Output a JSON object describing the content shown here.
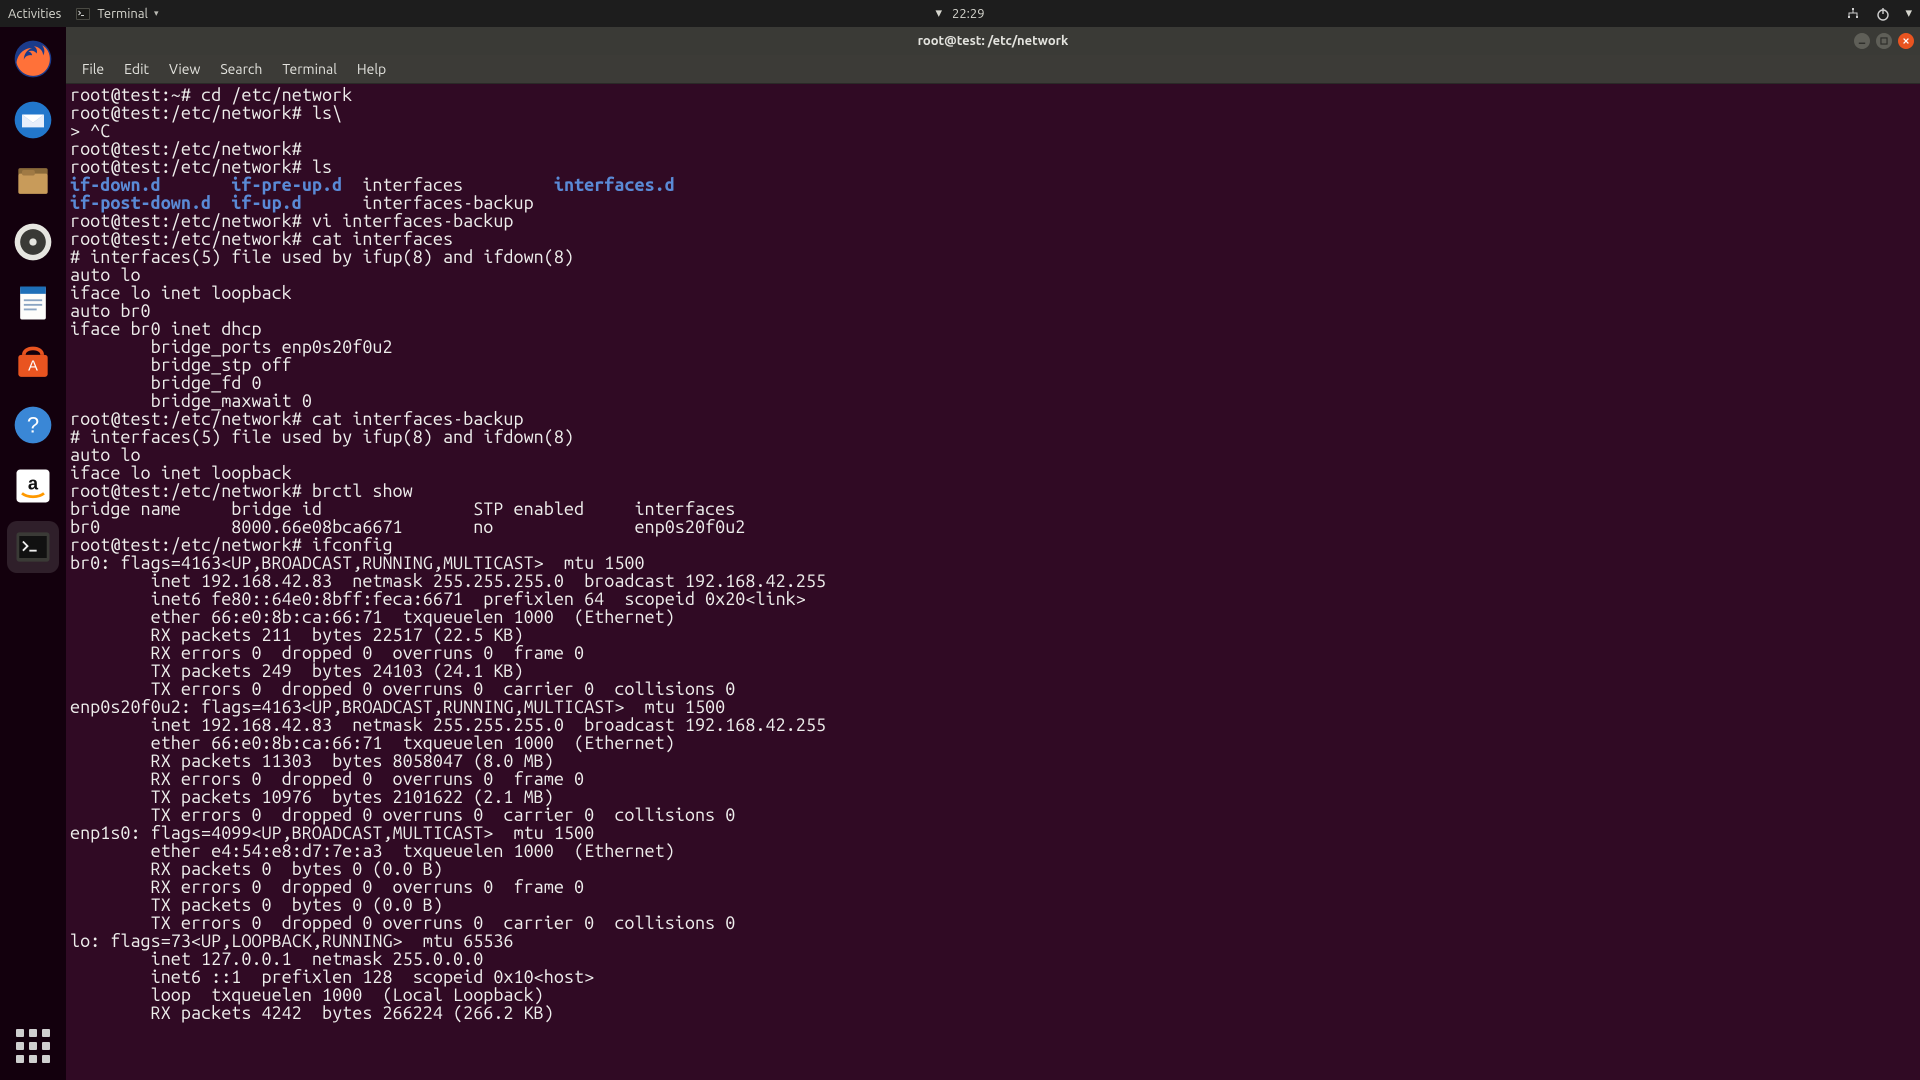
{
  "panel": {
    "activities": "Activities",
    "app_label": "Terminal",
    "clock": "22:29",
    "clock_glyph": "▾"
  },
  "dock": {
    "items": [
      {
        "name": "firefox"
      },
      {
        "name": "thunderbird"
      },
      {
        "name": "files"
      },
      {
        "name": "rhythmbox"
      },
      {
        "name": "libreoffice-writer"
      },
      {
        "name": "ubuntu-software"
      },
      {
        "name": "help"
      },
      {
        "name": "amazon"
      },
      {
        "name": "terminal"
      }
    ]
  },
  "window": {
    "title": "root@test: /etc/network",
    "menubar": [
      "File",
      "Edit",
      "View",
      "Search",
      "Terminal",
      "Help"
    ]
  },
  "terminal": {
    "lines": [
      {
        "segs": [
          {
            "t": "root@test:~# cd /etc/network"
          }
        ]
      },
      {
        "segs": [
          {
            "t": "root@test:/etc/network# ls\\"
          }
        ]
      },
      {
        "segs": [
          {
            "t": "> ^C"
          }
        ]
      },
      {
        "segs": [
          {
            "t": "root@test:/etc/network# "
          }
        ]
      },
      {
        "segs": [
          {
            "t": "root@test:/etc/network# ls"
          }
        ]
      },
      {
        "segs": [
          {
            "t": "if-down.d       ",
            "cls": "dir"
          },
          {
            "t": "if-pre-up.d",
            "cls": "dir"
          },
          {
            "t": "  interfaces         "
          },
          {
            "t": "interfaces.d",
            "cls": "dir"
          }
        ]
      },
      {
        "segs": [
          {
            "t": "if-post-down.d  ",
            "cls": "dir"
          },
          {
            "t": "if-up.d",
            "cls": "dir"
          },
          {
            "t": "      interfaces-backup"
          }
        ]
      },
      {
        "segs": [
          {
            "t": "root@test:/etc/network# vi interfaces-backup"
          }
        ]
      },
      {
        "segs": [
          {
            "t": "root@test:/etc/network# cat interfaces"
          }
        ]
      },
      {
        "segs": [
          {
            "t": "# interfaces(5) file used by ifup(8) and ifdown(8)"
          }
        ]
      },
      {
        "segs": [
          {
            "t": "auto lo"
          }
        ]
      },
      {
        "segs": [
          {
            "t": "iface lo inet loopback"
          }
        ]
      },
      {
        "segs": [
          {
            "t": ""
          }
        ]
      },
      {
        "segs": [
          {
            "t": "auto br0"
          }
        ]
      },
      {
        "segs": [
          {
            "t": "iface br0 inet dhcp"
          }
        ]
      },
      {
        "segs": [
          {
            "t": "        bridge_ports enp0s20f0u2"
          }
        ]
      },
      {
        "segs": [
          {
            "t": "        bridge_stp off"
          }
        ]
      },
      {
        "segs": [
          {
            "t": "        bridge_fd 0"
          }
        ]
      },
      {
        "segs": [
          {
            "t": "        bridge_maxwait 0"
          }
        ]
      },
      {
        "segs": [
          {
            "t": "root@test:/etc/network# cat interfaces-backup"
          }
        ]
      },
      {
        "segs": [
          {
            "t": "# interfaces(5) file used by ifup(8) and ifdown(8)"
          }
        ]
      },
      {
        "segs": [
          {
            "t": "auto lo"
          }
        ]
      },
      {
        "segs": [
          {
            "t": "iface lo inet loopback"
          }
        ]
      },
      {
        "segs": [
          {
            "t": "root@test:/etc/network# brctl show"
          }
        ]
      },
      {
        "segs": [
          {
            "t": "bridge name     bridge id               STP enabled     interfaces"
          }
        ]
      },
      {
        "segs": [
          {
            "t": "br0             8000.66e08bca6671       no              enp0s20f0u2"
          }
        ]
      },
      {
        "segs": [
          {
            "t": "root@test:/etc/network# ifconfig"
          }
        ]
      },
      {
        "segs": [
          {
            "t": "br0: flags=4163<UP,BROADCAST,RUNNING,MULTICAST>  mtu 1500"
          }
        ]
      },
      {
        "segs": [
          {
            "t": "        inet 192.168.42.83  netmask 255.255.255.0  broadcast 192.168.42.255"
          }
        ]
      },
      {
        "segs": [
          {
            "t": "        inet6 fe80::64e0:8bff:feca:6671  prefixlen 64  scopeid 0x20<link>"
          }
        ]
      },
      {
        "segs": [
          {
            "t": "        ether 66:e0:8b:ca:66:71  txqueuelen 1000  (Ethernet)"
          }
        ]
      },
      {
        "segs": [
          {
            "t": "        RX packets 211  bytes 22517 (22.5 KB)"
          }
        ]
      },
      {
        "segs": [
          {
            "t": "        RX errors 0  dropped 0  overruns 0  frame 0"
          }
        ]
      },
      {
        "segs": [
          {
            "t": "        TX packets 249  bytes 24103 (24.1 KB)"
          }
        ]
      },
      {
        "segs": [
          {
            "t": "        TX errors 0  dropped 0 overruns 0  carrier 0  collisions 0"
          }
        ]
      },
      {
        "segs": [
          {
            "t": ""
          }
        ]
      },
      {
        "segs": [
          {
            "t": "enp0s20f0u2: flags=4163<UP,BROADCAST,RUNNING,MULTICAST>  mtu 1500"
          }
        ]
      },
      {
        "segs": [
          {
            "t": "        inet 192.168.42.83  netmask 255.255.255.0  broadcast 192.168.42.255"
          }
        ]
      },
      {
        "segs": [
          {
            "t": "        ether 66:e0:8b:ca:66:71  txqueuelen 1000  (Ethernet)"
          }
        ]
      },
      {
        "segs": [
          {
            "t": "        RX packets 11303  bytes 8058047 (8.0 MB)"
          }
        ]
      },
      {
        "segs": [
          {
            "t": "        RX errors 0  dropped 0  overruns 0  frame 0"
          }
        ]
      },
      {
        "segs": [
          {
            "t": "        TX packets 10976  bytes 2101622 (2.1 MB)"
          }
        ]
      },
      {
        "segs": [
          {
            "t": "        TX errors 0  dropped 0 overruns 0  carrier 0  collisions 0"
          }
        ]
      },
      {
        "segs": [
          {
            "t": ""
          }
        ]
      },
      {
        "segs": [
          {
            "t": "enp1s0: flags=4099<UP,BROADCAST,MULTICAST>  mtu 1500"
          }
        ]
      },
      {
        "segs": [
          {
            "t": "        ether e4:54:e8:d7:7e:a3  txqueuelen 1000  (Ethernet)"
          }
        ]
      },
      {
        "segs": [
          {
            "t": "        RX packets 0  bytes 0 (0.0 B)"
          }
        ]
      },
      {
        "segs": [
          {
            "t": "        RX errors 0  dropped 0  overruns 0  frame 0"
          }
        ]
      },
      {
        "segs": [
          {
            "t": "        TX packets 0  bytes 0 (0.0 B)"
          }
        ]
      },
      {
        "segs": [
          {
            "t": "        TX errors 0  dropped 0 overruns 0  carrier 0  collisions 0"
          }
        ]
      },
      {
        "segs": [
          {
            "t": ""
          }
        ]
      },
      {
        "segs": [
          {
            "t": "lo: flags=73<UP,LOOPBACK,RUNNING>  mtu 65536"
          }
        ]
      },
      {
        "segs": [
          {
            "t": "        inet 127.0.0.1  netmask 255.0.0.0"
          }
        ]
      },
      {
        "segs": [
          {
            "t": "        inet6 ::1  prefixlen 128  scopeid 0x10<host>"
          }
        ]
      },
      {
        "segs": [
          {
            "t": "        loop  txqueuelen 1000  (Local Loopback)"
          }
        ]
      },
      {
        "segs": [
          {
            "t": "        RX packets 4242  bytes 266224 (266.2 KB)"
          }
        ]
      }
    ]
  }
}
